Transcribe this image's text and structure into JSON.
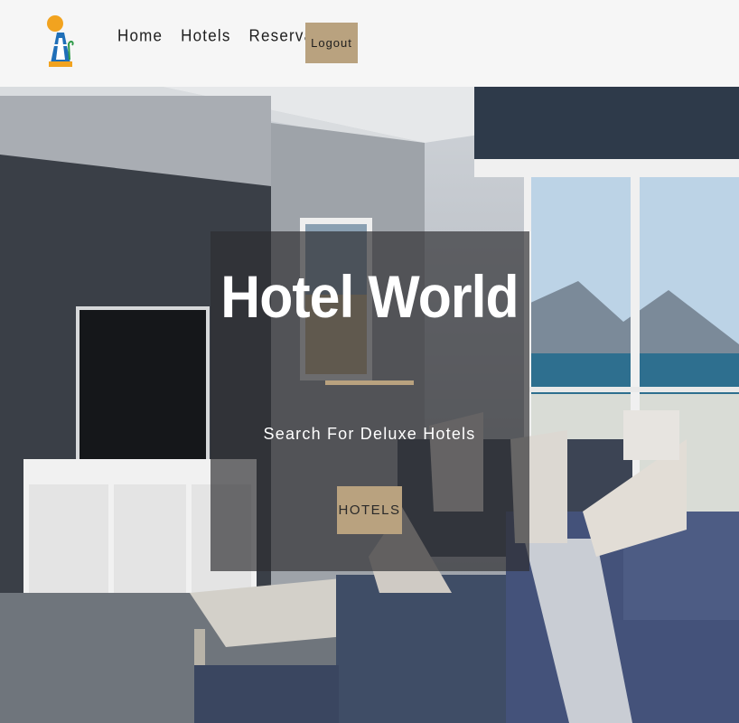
{
  "header": {
    "nav": {
      "home": "Home",
      "hotels": "Hotels",
      "reservation": "Reservation"
    },
    "logout_label": "Logout",
    "logo_icon": "hotel-logo-icon"
  },
  "hero": {
    "title": "Hotel World",
    "subtitle": "Search For Deluxe Hotels",
    "button_label": "HOTELS"
  },
  "colors": {
    "accent": "#b9a27f",
    "header_bg": "#f6f6f6",
    "overlay": "rgba(45,45,48,0.68)"
  }
}
